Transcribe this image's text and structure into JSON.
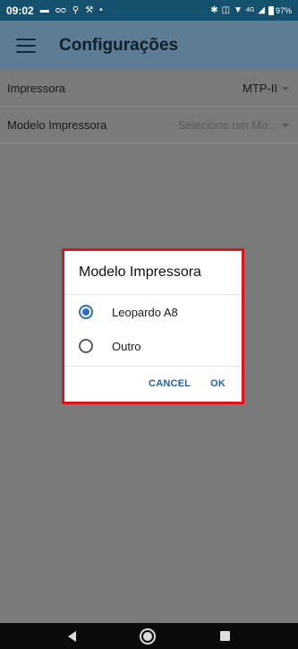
{
  "status_bar": {
    "time": "09:02",
    "network_label": "4G",
    "battery_percent": "97%"
  },
  "app_bar": {
    "title": "Configurações"
  },
  "settings": {
    "rows": [
      {
        "label": "Impressora",
        "value": "MTP-II"
      },
      {
        "label": "Modelo Impressora",
        "value": "Selecione um Mo..."
      }
    ]
  },
  "dialog": {
    "title": "Modelo Impressora",
    "options": [
      {
        "label": "Leopardo A8",
        "selected": true
      },
      {
        "label": "Outro",
        "selected": false
      }
    ],
    "cancel_label": "CANCEL",
    "ok_label": "OK"
  },
  "colors": {
    "status_bar": "#16506f",
    "app_bar": "#5e7c93",
    "highlight_border": "#e0141b",
    "accent": "#2c6fcb"
  }
}
